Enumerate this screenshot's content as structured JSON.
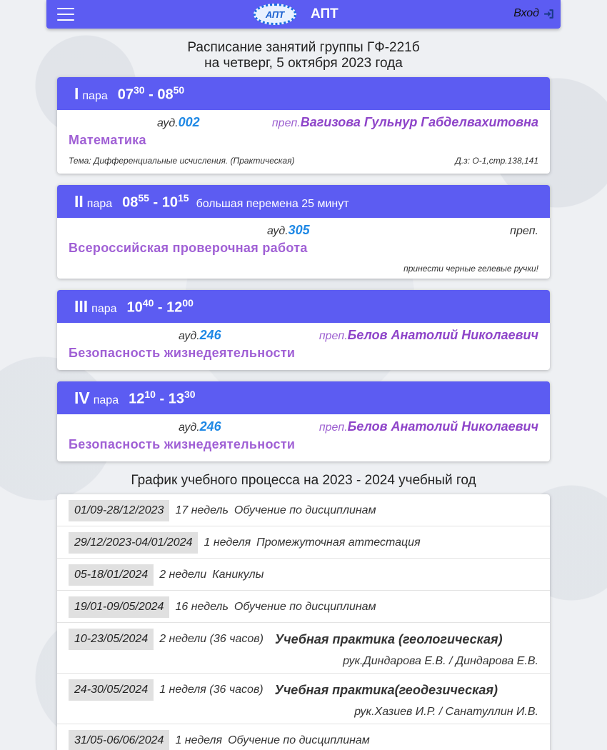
{
  "header": {
    "app_title": "АПТ",
    "logo_text": "АПТ",
    "login_label": "Вход"
  },
  "page": {
    "title_line1": "Расписание занятий группы ГФ-221б",
    "title_line2": "на четверг, 5 октября 2023 года"
  },
  "lessons": [
    {
      "roman": "I",
      "para_label": "пара",
      "start_h": "07",
      "start_m": "30",
      "end_h": "08",
      "end_m": "50",
      "note": "",
      "aud_label": "ауд.",
      "aud": "002",
      "prep_label": "преп.",
      "prep_name": "Вагизова Гульнур Габделвахитовна",
      "subject": "Математика",
      "footer_left": "Тема: Дифференциальные исчисления. (Практическая)",
      "footer_right": "Д.з: О-1,стр.138,141"
    },
    {
      "roman": "II",
      "para_label": "пара",
      "start_h": "08",
      "start_m": "55",
      "end_h": "10",
      "end_m": "15",
      "note": "большая перемена 25 минут",
      "aud_label": "ауд.",
      "aud": "305",
      "prep_label": "преп.",
      "prep_name": "",
      "subject": "Всероссийская проверочная работа",
      "footer_left": "",
      "footer_right": "принести черные гелевые ручки!"
    },
    {
      "roman": "III",
      "para_label": "пара",
      "start_h": "10",
      "start_m": "40",
      "end_h": "12",
      "end_m": "00",
      "note": "",
      "aud_label": "ауд.",
      "aud": "246",
      "prep_label": "преп.",
      "prep_name": "Белов Анатолий Николаевич",
      "subject": "Безопасность жизнедеятельности"
    },
    {
      "roman": "IV",
      "para_label": "пара",
      "start_h": "12",
      "start_m": "10",
      "end_h": "13",
      "end_m": "30",
      "note": "",
      "aud_label": "ауд.",
      "aud": "246",
      "prep_label": "преп.",
      "prep_name": "Белов Анатолий Николаевич",
      "subject": "Безопасность жизнедеятельности"
    }
  ],
  "schedule": {
    "title": "График учебного процесса на 2023 - 2024 учебный год",
    "rows": [
      {
        "dates": "01/09-28/12/2023",
        "duration": "17 недель",
        "activity": "Обучение по дисциплинам"
      },
      {
        "dates": "29/12/2023-04/01/2024",
        "duration": "1 неделя",
        "activity": "Промежуточная аттестация"
      },
      {
        "dates": "05-18/01/2024",
        "duration": "2 недели",
        "activity": "Каникулы"
      },
      {
        "dates": "19/01-09/05/2024",
        "duration": "16 недель",
        "activity": "Обучение по дисциплинам"
      },
      {
        "dates": "10-23/05/2024",
        "duration": "2 недели (36 часов)",
        "activity": "Учебная практика (геологическая)",
        "lead": "рук.Диндарова Е.В. / Диндарова Е.В."
      },
      {
        "dates": "24-30/05/2024",
        "duration": "1 неделя (36 часов)",
        "activity": "Учебная практика(геодезическая)",
        "lead": "рук.Хазиев И.Р. / Санатуллин И.В."
      },
      {
        "dates": "31/05-06/06/2024",
        "duration": "1 неделя",
        "activity": "Обучение по дисциплинам"
      }
    ]
  },
  "colors": {
    "accent": "#5c5cf2",
    "subject": "#a060d5",
    "room": "#1e88e5"
  }
}
